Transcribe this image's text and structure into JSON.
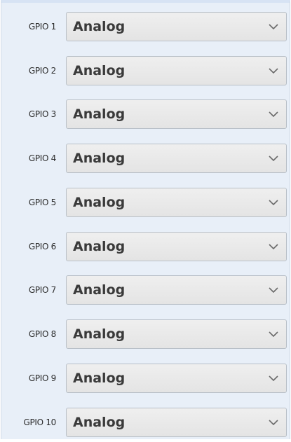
{
  "gpio_list": [
    {
      "label": "GPIO 1",
      "value": "Analog"
    },
    {
      "label": "GPIO 2",
      "value": "Analog"
    },
    {
      "label": "GPIO 3",
      "value": "Analog"
    },
    {
      "label": "GPIO 4",
      "value": "Analog"
    },
    {
      "label": "GPIO 5",
      "value": "Analog"
    },
    {
      "label": "GPIO 6",
      "value": "Analog"
    },
    {
      "label": "GPIO 7",
      "value": "Analog"
    },
    {
      "label": "GPIO 8",
      "value": "Analog"
    },
    {
      "label": "GPIO 9",
      "value": "Analog"
    },
    {
      "label": "GPIO 10",
      "value": "Analog"
    }
  ],
  "icons": {
    "dropdown": "chevron-down-icon"
  },
  "colors": {
    "panel_background": "#e8eff8",
    "select_background": "#e8e8e8",
    "select_border": "#b8bfc7",
    "text": "#3a3a3a"
  }
}
